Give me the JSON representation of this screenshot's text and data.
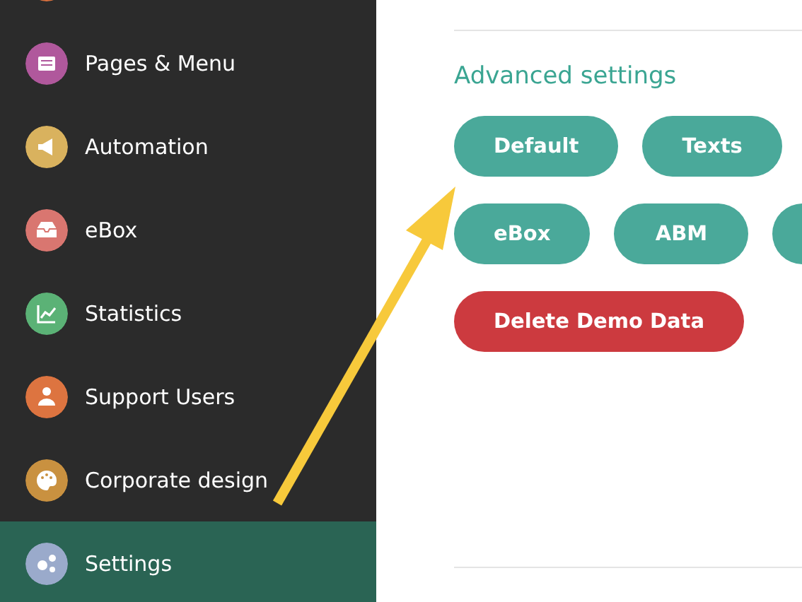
{
  "sidebar": {
    "items": [
      {
        "color": "#d9703e",
        "selected": false
      },
      {
        "label": "Pages & Menu",
        "color": "#b0589c",
        "selected": false
      },
      {
        "label": "Automation",
        "color": "#d9b25e",
        "selected": false
      },
      {
        "label": "eBox",
        "color": "#d97670",
        "selected": false
      },
      {
        "label": "Statistics",
        "color": "#5bb276",
        "selected": false
      },
      {
        "label": "Support Users",
        "color": "#dd7440",
        "selected": false
      },
      {
        "label": "Corporate design",
        "color": "#c99140",
        "selected": false
      },
      {
        "label": "Settings",
        "color": "#9aaacb",
        "selected": true
      }
    ]
  },
  "advanced_settings": {
    "title": "Advanced settings",
    "button_rows": [
      [
        {
          "label": "Default",
          "kind": "primary"
        },
        {
          "label": "Texts",
          "kind": "primary"
        }
      ],
      [
        {
          "label": "eBox",
          "kind": "primary"
        },
        {
          "label": "ABM",
          "kind": "primary"
        },
        {
          "kind": "primary"
        }
      ],
      [
        {
          "label": "Delete Demo Data",
          "kind": "danger"
        }
      ]
    ]
  }
}
